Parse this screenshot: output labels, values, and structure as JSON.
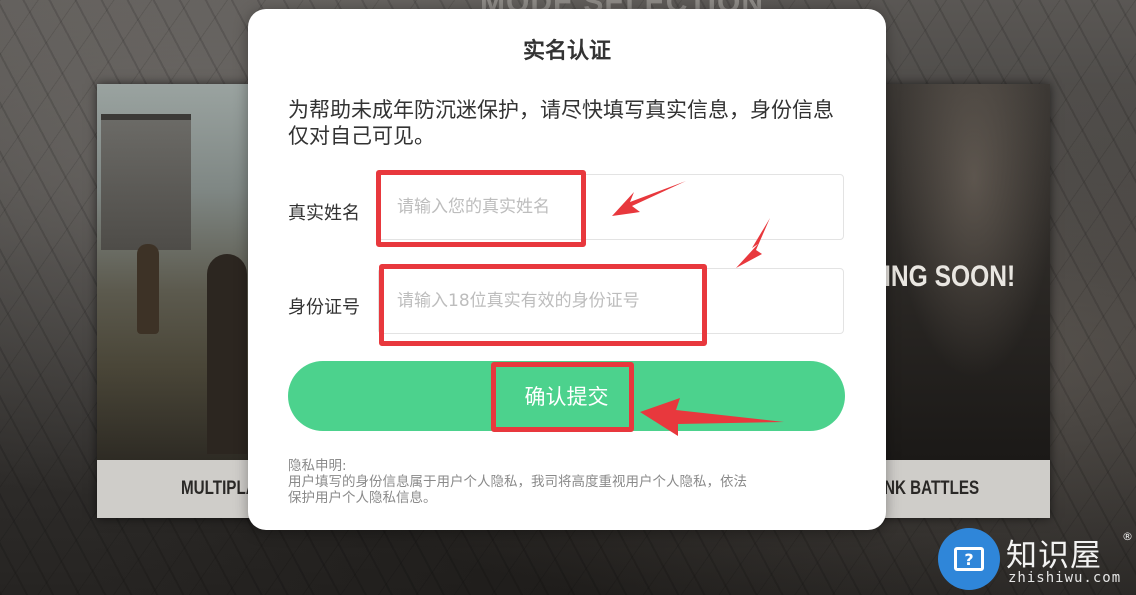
{
  "background": {
    "mode_title": "MODE SELECTION",
    "left_card_label": "MULTIPLA",
    "right_card_overlay": "ING SOON!",
    "right_card_label": "NK BATTLES"
  },
  "dialog": {
    "title": "实名认证",
    "notice": "为帮助未成年防沉迷保护，请尽快填写真实信息，身份信息仅对自己可见。",
    "name_field": {
      "label": "真实姓名",
      "placeholder": "请输入您的真实姓名",
      "value": ""
    },
    "id_field": {
      "label": "身份证号",
      "placeholder": "请输入18位真实有效的身份证号",
      "value": ""
    },
    "submit_label": "确认提交",
    "privacy": {
      "heading": "隐私申明:",
      "line1": "用户填写的身份信息属于用户个人隐私，我司将高度重视用户个人隐私，依法",
      "line2": "保护用户个人隐私信息。"
    }
  },
  "annotation": {
    "highlight_color": "#e8383d"
  },
  "watermark": {
    "icon_glyph": "?",
    "name_cn": "知识屋",
    "registered": "®",
    "domain": "zhishiwu.com"
  },
  "colors": {
    "accent_green": "#4cd28d",
    "dialog_bg": "#ffffff",
    "placeholder_gray": "#bdbdbd"
  }
}
